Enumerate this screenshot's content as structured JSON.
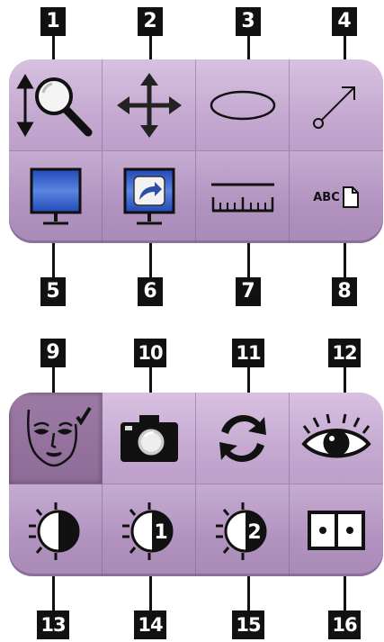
{
  "top_panel": {
    "callouts_top": [
      "1",
      "2",
      "3",
      "4"
    ],
    "callouts_bottom": [
      "5",
      "6",
      "7",
      "8"
    ],
    "tools": [
      {
        "icon": "zoom-icon"
      },
      {
        "icon": "pan-icon"
      },
      {
        "icon": "ellipse-icon"
      },
      {
        "icon": "arrow-icon"
      },
      {
        "icon": "monitor-icon"
      },
      {
        "icon": "monitor-share-icon"
      },
      {
        "icon": "ruler-icon"
      },
      {
        "icon": "annotation-text-icon",
        "text": "ABC"
      }
    ]
  },
  "bottom_panel": {
    "callouts_top": [
      "9",
      "10",
      "11",
      "12"
    ],
    "callouts_bottom": [
      "13",
      "14",
      "15",
      "16"
    ],
    "tools": [
      {
        "icon": "face-check-icon",
        "active": true
      },
      {
        "icon": "camera-icon"
      },
      {
        "icon": "refresh-icon"
      },
      {
        "icon": "eye-icon"
      },
      {
        "icon": "contrast-icon"
      },
      {
        "icon": "contrast-1-icon",
        "text": "1"
      },
      {
        "icon": "contrast-2-icon",
        "text": "2"
      },
      {
        "icon": "dual-view-icon"
      }
    ]
  },
  "colors": {
    "panel": "#bb9dc8",
    "active": "#8e6c98",
    "callout": "#111111",
    "monitor": "#3a62c8"
  }
}
